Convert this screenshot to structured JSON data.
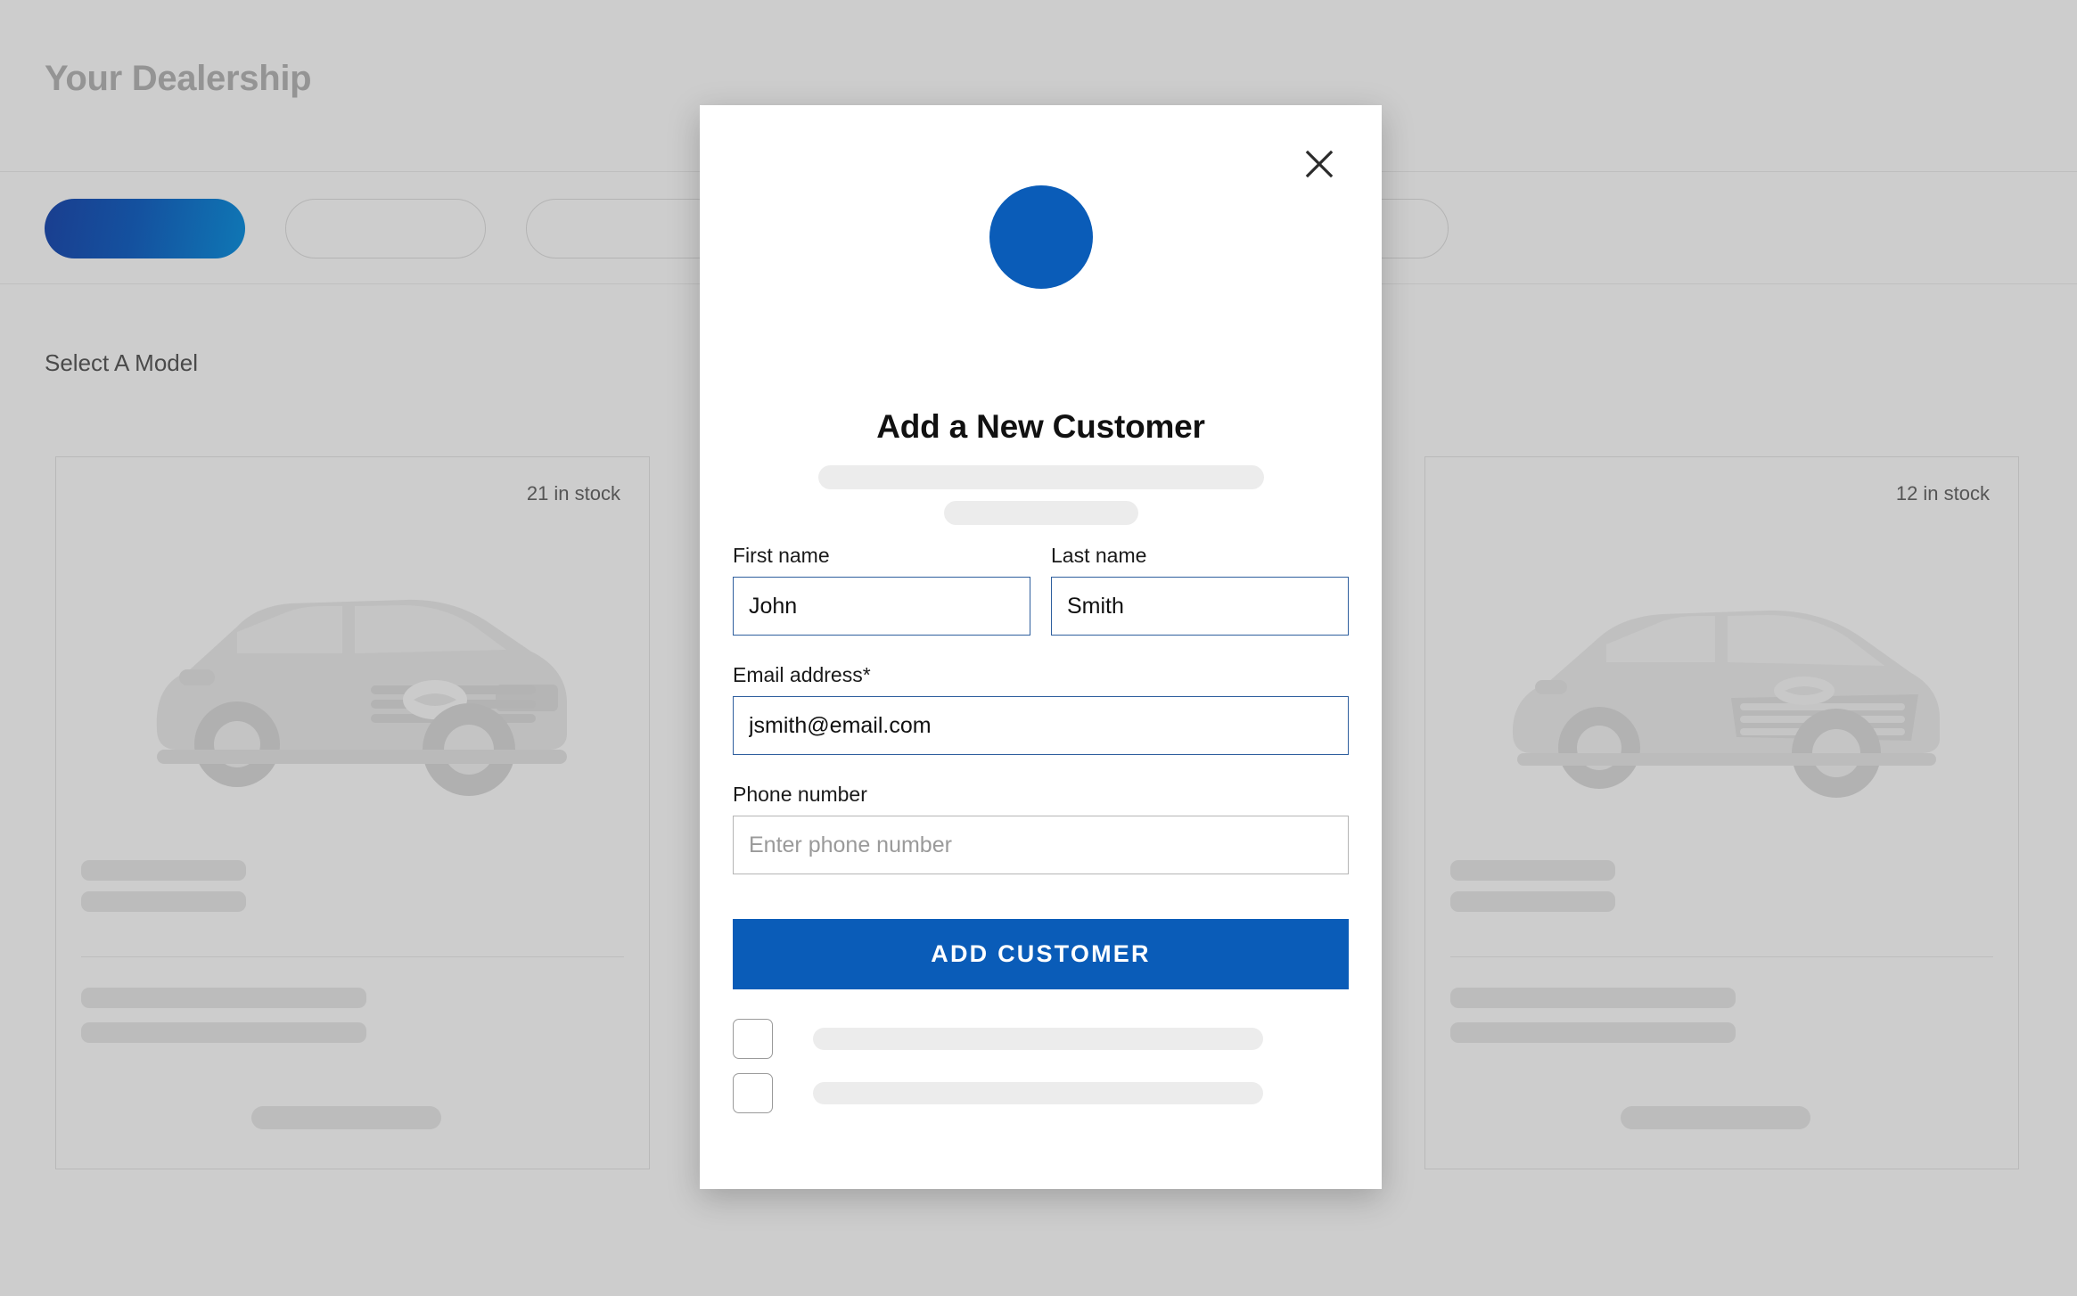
{
  "background": {
    "page_title": "Your Dealership",
    "section_label": "Select A Model",
    "nav": {
      "items": [
        {
          "label": "",
          "state": "active"
        },
        {
          "label": "",
          "state": "inactive"
        },
        {
          "label": "",
          "state": "inactive"
        },
        {
          "label": "",
          "state": "inactive"
        },
        {
          "label": "",
          "state": "inactive"
        },
        {
          "label": "",
          "state": "inactive"
        }
      ],
      "active_gradient_from": "#1a3e8f",
      "active_gradient_to": "#0f77b5"
    },
    "cards": [
      {
        "stock_label": "21 in stock",
        "vehicle": "hyundai-tucson-suv"
      },
      {
        "stock_label": "12 in stock",
        "vehicle": "hyundai-elantra-sedan"
      }
    ]
  },
  "modal": {
    "close_icon": "close-icon",
    "avatar_icon": "avatar-circle",
    "avatar_color": "#0a5cb8",
    "title": "Add a New Customer",
    "fields": {
      "first_name": {
        "label": "First name",
        "value": "John",
        "placeholder": ""
      },
      "last_name": {
        "label": "Last name",
        "value": "Smith",
        "placeholder": ""
      },
      "email": {
        "label": "Email address*",
        "value": "jsmith@email.com",
        "placeholder": ""
      },
      "phone": {
        "label": "Phone number",
        "value": "",
        "placeholder": "Enter phone number"
      }
    },
    "submit_label": "ADD CUSTOMER",
    "submit_color": "#0a5cb8",
    "checkboxes": [
      {
        "checked": false,
        "label": ""
      },
      {
        "checked": false,
        "label": ""
      }
    ]
  }
}
